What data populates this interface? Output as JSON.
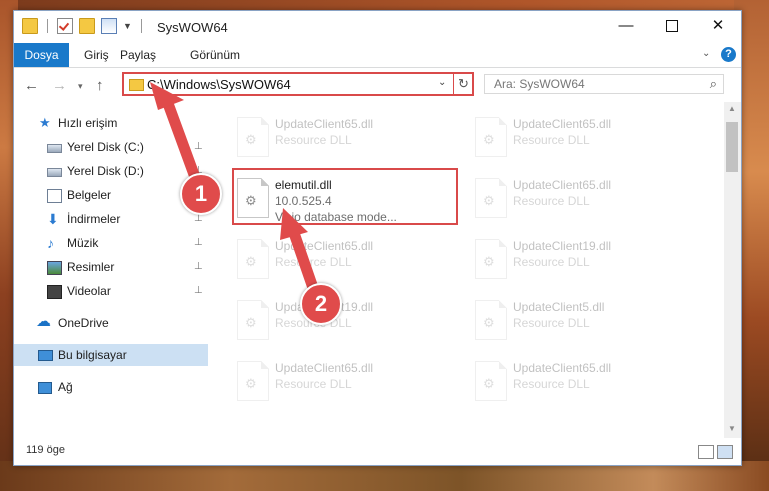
{
  "window": {
    "title": "SysWOW64",
    "minimize_label": "—",
    "close_label": "✕"
  },
  "ribbon": {
    "tabs": [
      "Dosya",
      "Giriş",
      "Paylaş",
      "Görünüm"
    ],
    "help_label": "?",
    "expand_label": "⌄"
  },
  "nav": {
    "back": "←",
    "forward": "→",
    "recent": "▾",
    "up": "↑",
    "address": "C:\\Windows\\SysWOW64",
    "address_dropdown": "⌄",
    "refresh": "↻",
    "search_placeholder": "Ara: SysWOW64",
    "search_icon": "⌕"
  },
  "sidebar": {
    "items": [
      {
        "label": "Hızlı erişim",
        "icon": "star-icon"
      },
      {
        "label": "Yerel Disk (C:)",
        "icon": "drive-icon",
        "pinned": true
      },
      {
        "label": "Yerel Disk (D:)",
        "icon": "drive-icon",
        "pinned": true
      },
      {
        "label": "Belgeler",
        "icon": "documents-icon"
      },
      {
        "label": "İndirmeler",
        "icon": "downloads-icon",
        "pinned": true
      },
      {
        "label": "Müzik",
        "icon": "music-icon",
        "pinned": true
      },
      {
        "label": "Resimler",
        "icon": "pictures-icon",
        "pinned": true
      },
      {
        "label": "Videolar",
        "icon": "videos-icon",
        "pinned": true
      },
      {
        "label": "OneDrive",
        "icon": "onedrive-icon"
      },
      {
        "label": "Bu bilgisayar",
        "icon": "computer-icon",
        "selected": true
      },
      {
        "label": "Ağ",
        "icon": "network-icon"
      }
    ],
    "pin_glyph": "📌"
  },
  "files": [
    {
      "name": "UpdateClient65.dll",
      "type": "Resource DLL"
    },
    {
      "name": "UpdateClient65.dll",
      "type": "Resource DLL"
    },
    {
      "name": "elemutil.dll",
      "version": "10.0.525.4",
      "desc": "Visio database mode..."
    },
    {
      "name": "UpdateClient65.dll",
      "type": "Resource DLL"
    },
    {
      "name": "UpdateClient65.dll",
      "type": "Resource DLL"
    },
    {
      "name": "UpdateClient19.dll",
      "type": "Resource DLL"
    },
    {
      "name": "UpdateClient19.dll",
      "type": "Resource DLL"
    },
    {
      "name": "UpdateClient5.dll",
      "type": "Resource DLL"
    },
    {
      "name": "UpdateClient65.dll",
      "type": "Resource DLL"
    },
    {
      "name": "UpdateClient65.dll",
      "type": "Resource DLL"
    }
  ],
  "status": {
    "item_count": "119 öge"
  },
  "annotations": {
    "step1": "1",
    "step2": "2",
    "color": "#e04b4b"
  }
}
